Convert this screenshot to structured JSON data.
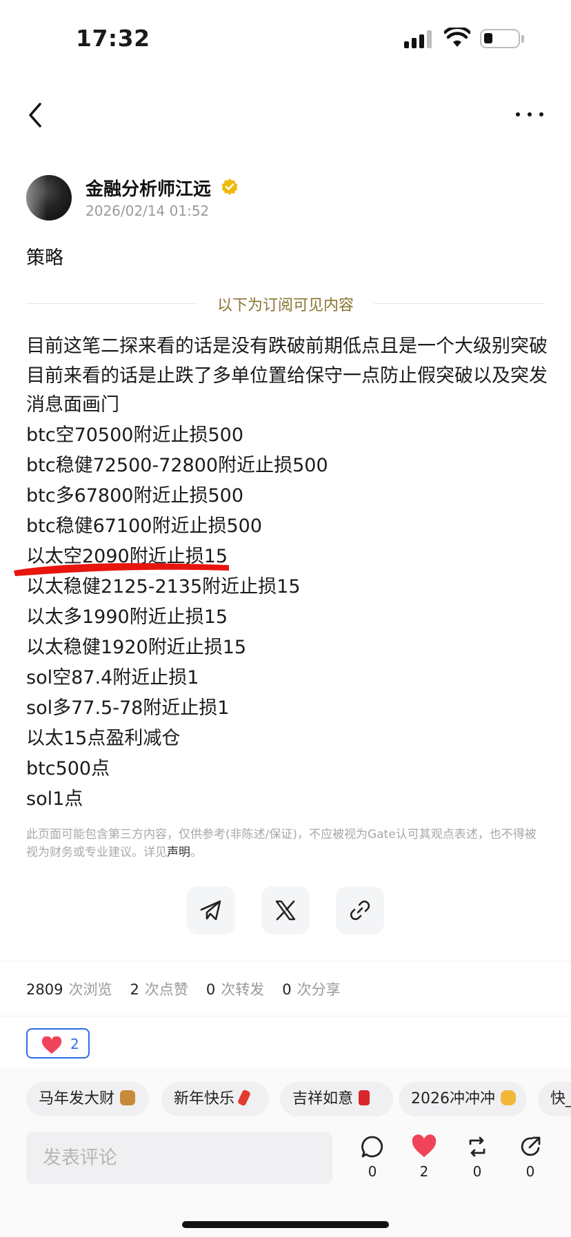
{
  "status_bar": {
    "time": "17:32"
  },
  "post": {
    "author": "金融分析师江远",
    "date": "2026/02/14 01:52",
    "title": "策略",
    "divider_label": "以下为订阅可见内容",
    "paragraph": "目前这笔二探来看的话是没有跌破前期低点且是一个大级别突破目前来看的话是止跌了多单位置给保守一点防止假突破以及突发消息面画门",
    "lines": [
      "btc空70500附近止损500",
      "btc稳健72500-72800附近止损500",
      "btc多67800附近止损500",
      "btc稳健67100附近止损500",
      "以太空2090附近止损15",
      "以太稳健2125-2135附近止损15",
      "以太多1990附近止损15",
      "以太稳健1920附近止损15",
      "sol空87.4附近止损1",
      "sol多77.5-78附近止损1",
      "以太15点盈利减仓",
      "btc500点",
      "sol1点"
    ],
    "disclaimer": "此页面可能包含第三方内容，仅供参考(非陈述/保证)，不应被视为Gate认可其观点表述，也不得被视为财务或专业建议。详见",
    "disclaimer_link": "声明",
    "disclaimer_end": "。"
  },
  "share_icons": [
    "telegram-icon",
    "x-icon",
    "link-icon"
  ],
  "stats": {
    "views": "2809",
    "views_label": "次浏览",
    "likes": "2",
    "likes_label": "次点赞",
    "reposts": "0",
    "reposts_label": "次转发",
    "shares": "0",
    "shares_label": "次分享"
  },
  "reaction": {
    "count": "2",
    "icon": "heart-icon"
  },
  "chips": [
    "马年发大财",
    "新年快乐",
    "吉祥如意",
    "2026冲冲冲",
    "快_"
  ],
  "comment": {
    "placeholder": "发表评论"
  },
  "actions": {
    "comment_count": "0",
    "like_count": "2",
    "repost_count": "0",
    "share_count": "0"
  },
  "colors": {
    "accent": "#2e6ce6",
    "heart": "#f0435a",
    "gold": "#8a7230"
  }
}
